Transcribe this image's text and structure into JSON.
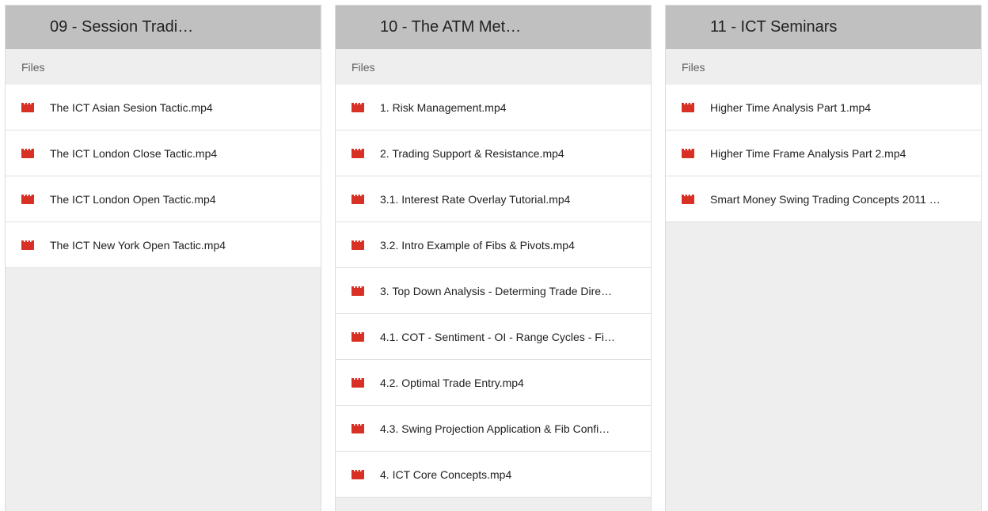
{
  "colors": {
    "icon_red": "#d93025",
    "header_bg": "#c0c0c0",
    "section_bg": "#eeeeee"
  },
  "columns": [
    {
      "title": "09 - Session Tradi…",
      "section_label": "Files",
      "files": [
        {
          "name": "The ICT Asian Sesion Tactic.mp4",
          "icon": "video-clapperboard-icon"
        },
        {
          "name": "The ICT London Close Tactic.mp4",
          "icon": "video-clapperboard-icon"
        },
        {
          "name": "The ICT London Open Tactic.mp4",
          "icon": "video-clapperboard-icon"
        },
        {
          "name": "The ICT New York Open Tactic.mp4",
          "icon": "video-clapperboard-icon"
        }
      ]
    },
    {
      "title": "10 - The ATM Met…",
      "section_label": "Files",
      "files": [
        {
          "name": "1. Risk Management.mp4",
          "icon": "video-clapperboard-icon"
        },
        {
          "name": "2. Trading Support & Resistance.mp4",
          "icon": "video-clapperboard-icon"
        },
        {
          "name": "3.1. Interest Rate Overlay Tutorial.mp4",
          "icon": "video-clapperboard-icon"
        },
        {
          "name": "3.2. Intro Example of Fibs & Pivots.mp4",
          "icon": "video-clapperboard-icon"
        },
        {
          "name": "3. Top Down Analysis - Determing Trade Dire…",
          "icon": "video-clapperboard-icon"
        },
        {
          "name": "4.1. COT - Sentiment - OI - Range Cycles - Fib…",
          "icon": "video-clapperboard-icon"
        },
        {
          "name": "4.2. Optimal Trade Entry.mp4",
          "icon": "video-clapperboard-icon"
        },
        {
          "name": "4.3. Swing Projection Application & Fib Confi…",
          "icon": "video-clapperboard-icon"
        },
        {
          "name": "4. ICT Core Concepts.mp4",
          "icon": "video-clapperboard-icon"
        }
      ]
    },
    {
      "title": "11 - ICT Seminars",
      "section_label": "Files",
      "files": [
        {
          "name": "Higher Time Analysis Part 1.mp4",
          "icon": "video-clapperboard-icon"
        },
        {
          "name": "Higher Time Frame Analysis Part 2.mp4",
          "icon": "video-clapperboard-icon"
        },
        {
          "name": "Smart Money Swing Trading Concepts 2011 …",
          "icon": "video-clapperboard-icon"
        }
      ]
    }
  ]
}
